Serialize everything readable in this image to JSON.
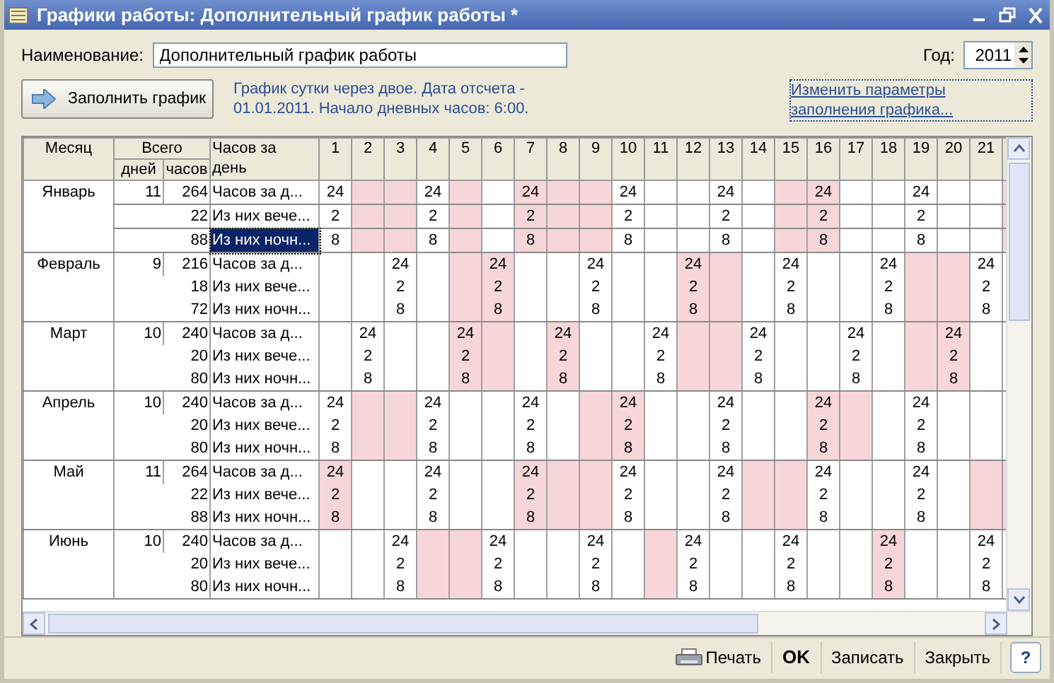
{
  "window": {
    "title": "Графики работы: Дополнительный график работы *"
  },
  "name_field": {
    "label": "Наименование:",
    "value": "Дополнительный график работы"
  },
  "year_field": {
    "label": "Год:",
    "value": "2011"
  },
  "fill_button": {
    "label": "Заполнить график"
  },
  "info_text": "График сутки через двое. Дата отсчета - 01.01.2011. Начало дневных часов: 6:00.",
  "change_link": "Изменить параметры заполнения графика...",
  "table": {
    "columns": {
      "month": "Месяц",
      "total": "Всего",
      "days": "дней",
      "hours": "часов",
      "per_day": "Часов за день"
    },
    "day_columns": [
      "1",
      "2",
      "3",
      "4",
      "5",
      "6",
      "7",
      "8",
      "9",
      "10",
      "11",
      "12",
      "13",
      "14",
      "15",
      "16",
      "17",
      "18",
      "19",
      "20",
      "21"
    ],
    "months": [
      {
        "name": "Январь",
        "days": "11",
        "edge_shaded": true,
        "rows": [
          {
            "total": "264",
            "label": "Часов за д...",
            "selected": false
          },
          {
            "total": "22",
            "label": "Из них вече...",
            "selected": false
          },
          {
            "total": "88",
            "label": "Из них ночн...",
            "selected": true
          }
        ],
        "cells": [
          {
            "shaded": false,
            "values": [
              "24",
              "2",
              "8"
            ]
          },
          {
            "shaded": true
          },
          {
            "shaded": true
          },
          {
            "shaded": false,
            "values": [
              "24",
              "2",
              "8"
            ]
          },
          {
            "shaded": true
          },
          {
            "shaded": false
          },
          {
            "shaded": true,
            "values": [
              "24",
              "2",
              "8"
            ]
          },
          {
            "shaded": true
          },
          {
            "shaded": true
          },
          {
            "shaded": false,
            "values": [
              "24",
              "2",
              "8"
            ]
          },
          {
            "shaded": false
          },
          {
            "shaded": false
          },
          {
            "shaded": false,
            "values": [
              "24",
              "2",
              "8"
            ]
          },
          {
            "shaded": false
          },
          {
            "shaded": true
          },
          {
            "shaded": true,
            "values": [
              "24",
              "2",
              "8"
            ]
          },
          {
            "shaded": false
          },
          {
            "shaded": false
          },
          {
            "shaded": false,
            "values": [
              "24",
              "2",
              "8"
            ]
          },
          {
            "shaded": false
          },
          {
            "shaded": false
          }
        ]
      },
      {
        "name": "Февраль",
        "days": "9",
        "edge_shaded": false,
        "rows": [
          {
            "total": "216",
            "label": "Часов за д...",
            "selected": false
          },
          {
            "total": "18",
            "label": "Из них вече...",
            "selected": false
          },
          {
            "total": "72",
            "label": "Из них ночн...",
            "selected": false
          }
        ],
        "cells": [
          {
            "shaded": false
          },
          {
            "shaded": false
          },
          {
            "shaded": false,
            "values": [
              "24",
              "2",
              "8"
            ]
          },
          {
            "shaded": false
          },
          {
            "shaded": true
          },
          {
            "shaded": true,
            "values": [
              "24",
              "2",
              "8"
            ]
          },
          {
            "shaded": false
          },
          {
            "shaded": false
          },
          {
            "shaded": false,
            "values": [
              "24",
              "2",
              "8"
            ]
          },
          {
            "shaded": false
          },
          {
            "shaded": false
          },
          {
            "shaded": true,
            "values": [
              "24",
              "2",
              "8"
            ]
          },
          {
            "shaded": true
          },
          {
            "shaded": false
          },
          {
            "shaded": false,
            "values": [
              "24",
              "2",
              "8"
            ]
          },
          {
            "shaded": false
          },
          {
            "shaded": false
          },
          {
            "shaded": false,
            "values": [
              "24",
              "2",
              "8"
            ]
          },
          {
            "shaded": true
          },
          {
            "shaded": true
          },
          {
            "shaded": false,
            "values": [
              "24",
              "2",
              "8"
            ]
          }
        ]
      },
      {
        "name": "Март",
        "days": "10",
        "edge_shaded": false,
        "rows": [
          {
            "total": "240",
            "label": "Часов за д...",
            "selected": false
          },
          {
            "total": "20",
            "label": "Из них вече...",
            "selected": false
          },
          {
            "total": "80",
            "label": "Из них ночн...",
            "selected": false
          }
        ],
        "cells": [
          {
            "shaded": false
          },
          {
            "shaded": false,
            "values": [
              "24",
              "2",
              "8"
            ]
          },
          {
            "shaded": false
          },
          {
            "shaded": false
          },
          {
            "shaded": true,
            "values": [
              "24",
              "2",
              "8"
            ]
          },
          {
            "shaded": true
          },
          {
            "shaded": false
          },
          {
            "shaded": true,
            "values": [
              "24",
              "2",
              "8"
            ]
          },
          {
            "shaded": false
          },
          {
            "shaded": false
          },
          {
            "shaded": false,
            "values": [
              "24",
              "2",
              "8"
            ]
          },
          {
            "shaded": true
          },
          {
            "shaded": true
          },
          {
            "shaded": false,
            "values": [
              "24",
              "2",
              "8"
            ]
          },
          {
            "shaded": false
          },
          {
            "shaded": false
          },
          {
            "shaded": false,
            "values": [
              "24",
              "2",
              "8"
            ]
          },
          {
            "shaded": false
          },
          {
            "shaded": true
          },
          {
            "shaded": true,
            "values": [
              "24",
              "2",
              "8"
            ]
          },
          {
            "shaded": false
          }
        ]
      },
      {
        "name": "Апрель",
        "days": "10",
        "edge_shaded": false,
        "rows": [
          {
            "total": "240",
            "label": "Часов за д...",
            "selected": false
          },
          {
            "total": "20",
            "label": "Из них вече...",
            "selected": false
          },
          {
            "total": "80",
            "label": "Из них ночн...",
            "selected": false
          }
        ],
        "cells": [
          {
            "shaded": false,
            "values": [
              "24",
              "2",
              "8"
            ]
          },
          {
            "shaded": true
          },
          {
            "shaded": true
          },
          {
            "shaded": false,
            "values": [
              "24",
              "2",
              "8"
            ]
          },
          {
            "shaded": false
          },
          {
            "shaded": false
          },
          {
            "shaded": false,
            "values": [
              "24",
              "2",
              "8"
            ]
          },
          {
            "shaded": false
          },
          {
            "shaded": true
          },
          {
            "shaded": true,
            "values": [
              "24",
              "2",
              "8"
            ]
          },
          {
            "shaded": false
          },
          {
            "shaded": false
          },
          {
            "shaded": false,
            "values": [
              "24",
              "2",
              "8"
            ]
          },
          {
            "shaded": false
          },
          {
            "shaded": false
          },
          {
            "shaded": true,
            "values": [
              "24",
              "2",
              "8"
            ]
          },
          {
            "shaded": true
          },
          {
            "shaded": false
          },
          {
            "shaded": false,
            "values": [
              "24",
              "2",
              "8"
            ]
          },
          {
            "shaded": false
          },
          {
            "shaded": false
          }
        ]
      },
      {
        "name": "Май",
        "days": "11",
        "edge_shaded": true,
        "rows": [
          {
            "total": "264",
            "label": "Часов за д...",
            "selected": false
          },
          {
            "total": "22",
            "label": "Из них вече...",
            "selected": false
          },
          {
            "total": "88",
            "label": "Из них ночн...",
            "selected": false
          }
        ],
        "cells": [
          {
            "shaded": true,
            "values": [
              "24",
              "2",
              "8"
            ]
          },
          {
            "shaded": false
          },
          {
            "shaded": false
          },
          {
            "shaded": false,
            "values": [
              "24",
              "2",
              "8"
            ]
          },
          {
            "shaded": false
          },
          {
            "shaded": false
          },
          {
            "shaded": true,
            "values": [
              "24",
              "2",
              "8"
            ]
          },
          {
            "shaded": true
          },
          {
            "shaded": true
          },
          {
            "shaded": false,
            "values": [
              "24",
              "2",
              "8"
            ]
          },
          {
            "shaded": false
          },
          {
            "shaded": false
          },
          {
            "shaded": false,
            "values": [
              "24",
              "2",
              "8"
            ]
          },
          {
            "shaded": true
          },
          {
            "shaded": true
          },
          {
            "shaded": false,
            "values": [
              "24",
              "2",
              "8"
            ]
          },
          {
            "shaded": false
          },
          {
            "shaded": false
          },
          {
            "shaded": false,
            "values": [
              "24",
              "2",
              "8"
            ]
          },
          {
            "shaded": false
          },
          {
            "shaded": true
          }
        ]
      },
      {
        "name": "Июнь",
        "days": "10",
        "edge_shaded": false,
        "rows": [
          {
            "total": "240",
            "label": "Часов за д...",
            "selected": false
          },
          {
            "total": "20",
            "label": "Из них вече...",
            "selected": false
          },
          {
            "total": "80",
            "label": "Из них ночн...",
            "selected": false
          }
        ],
        "cells": [
          {
            "shaded": false
          },
          {
            "shaded": false
          },
          {
            "shaded": false,
            "values": [
              "24",
              "2",
              "8"
            ]
          },
          {
            "shaded": true
          },
          {
            "shaded": true
          },
          {
            "shaded": false,
            "values": [
              "24",
              "2",
              "8"
            ]
          },
          {
            "shaded": false
          },
          {
            "shaded": false
          },
          {
            "shaded": false,
            "values": [
              "24",
              "2",
              "8"
            ]
          },
          {
            "shaded": false
          },
          {
            "shaded": true
          },
          {
            "shaded": false,
            "values": [
              "24",
              "2",
              "8"
            ]
          },
          {
            "shaded": false
          },
          {
            "shaded": false
          },
          {
            "shaded": false,
            "values": [
              "24",
              "2",
              "8"
            ]
          },
          {
            "shaded": false
          },
          {
            "shaded": false
          },
          {
            "shaded": true,
            "values": [
              "24",
              "2",
              "8"
            ]
          },
          {
            "shaded": false
          },
          {
            "shaded": false
          },
          {
            "shaded": false,
            "values": [
              "24",
              "2",
              "8"
            ]
          }
        ]
      }
    ]
  },
  "footer_buttons": [
    {
      "kind": "print",
      "label": "Печать"
    },
    {
      "kind": "ok",
      "label": "OK"
    },
    {
      "kind": "plain",
      "label": "Записать"
    },
    {
      "kind": "plain",
      "label": "Закрыть"
    },
    {
      "kind": "help",
      "label": "?"
    }
  ]
}
